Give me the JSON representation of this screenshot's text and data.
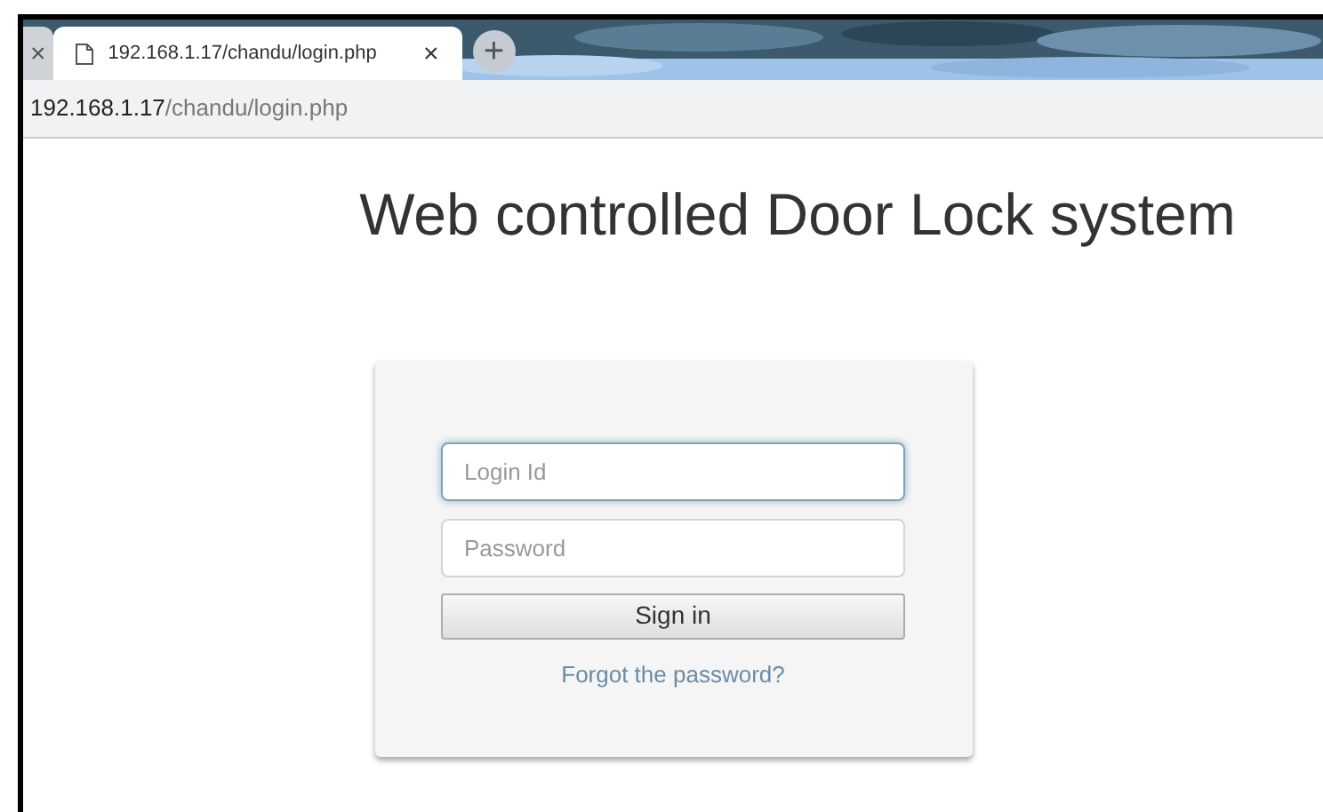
{
  "browser": {
    "tabs": [
      {
        "close": "×",
        "selected": false
      },
      {
        "title": "192.168.1.17/chandu/login.php",
        "close": "×",
        "selected": true
      }
    ],
    "new_tab": "+",
    "address": {
      "host": "192.168.1.17",
      "path": "/chandu/login.php"
    }
  },
  "page": {
    "heading": "Web controlled Door Lock system",
    "form": {
      "fields": [
        {
          "placeholder": "Login Id",
          "focused": true
        },
        {
          "placeholder": "Password",
          "focused": false
        }
      ],
      "submit": "Sign in",
      "link": "Forgot the password?"
    }
  }
}
